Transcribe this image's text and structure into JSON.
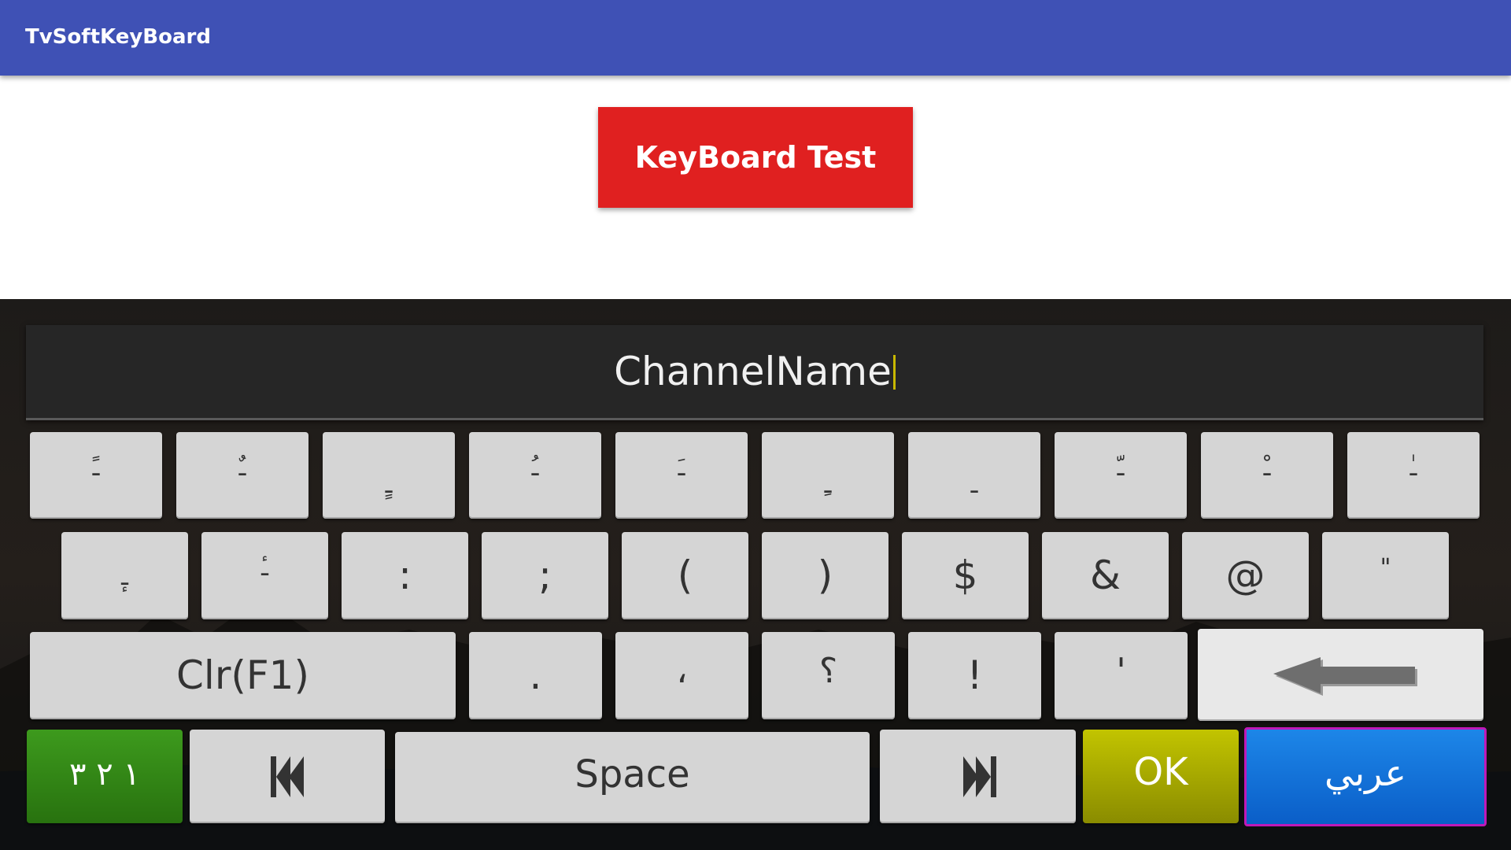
{
  "app": {
    "title": "TvSoftKeyBoard"
  },
  "main": {
    "button_label": "KeyBoard Test"
  },
  "input": {
    "value": "ChannelName"
  },
  "keyboard": {
    "row1": [
      "ـً",
      "ـٌ",
      "ـٍ",
      "ـُ",
      "ـَ",
      "ـِ",
      "ـ",
      "ـّ",
      "ـْ",
      "ـٰ"
    ],
    "row2": [
      "ـٕ",
      "ـٔ",
      ":",
      ";",
      "(",
      ")",
      "$",
      "&",
      "@",
      "\""
    ],
    "row3": {
      "clear": "Clr(F1)",
      "keys": [
        ".",
        "،",
        "؟",
        "!",
        "'"
      ]
    },
    "row4": {
      "numbers": "١ ٢ ٣",
      "space": "Space",
      "ok": "OK",
      "language": "عربي"
    }
  },
  "icons": {
    "backspace": "left-arrow-icon",
    "prev": "skip-previous-icon",
    "next": "skip-next-icon"
  },
  "colors": {
    "appbar": "#3f51b5",
    "test_button": "#e02020",
    "numbers_key": "#28720f",
    "ok_key": "#8a8c00",
    "language_key": "#0a5ec8",
    "focus_border": "#c019b8"
  }
}
